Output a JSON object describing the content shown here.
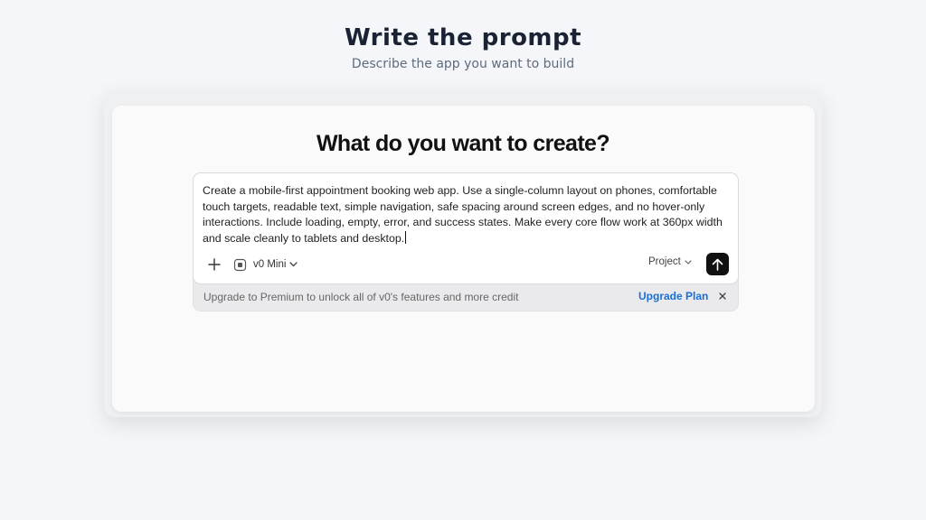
{
  "header": {
    "title": "Write the prompt",
    "subtitle": "Describe the app you want to build"
  },
  "card": {
    "heading": "What do you want to create?"
  },
  "composer": {
    "prompt_text": "Create a mobile-first appointment booking web app. Use a single-column layout on phones, comfortable touch targets, readable text, simple navigation, safe spacing around screen edges, and no hover-only interactions. Include loading, empty, error, and success states. Make every core flow work at 360px width and scale cleanly to tablets and desktop.",
    "model_label": "v0 Mini",
    "project_label": "Project"
  },
  "upgrade": {
    "text": "Upgrade to Premium to unlock all of v0's features and more credit",
    "link_label": "Upgrade Plan"
  },
  "icons": {
    "add": "plus-icon",
    "model": "chip-icon",
    "model_chevron": "chevron-down-icon",
    "project_chevron": "chevron-down-icon",
    "send": "arrow-up-icon",
    "close": "close-icon"
  },
  "colors": {
    "background": "#f4f6f9",
    "send_button": "#111111",
    "link": "#1a6fd6",
    "upgrade_bar": "#eaeaec"
  }
}
